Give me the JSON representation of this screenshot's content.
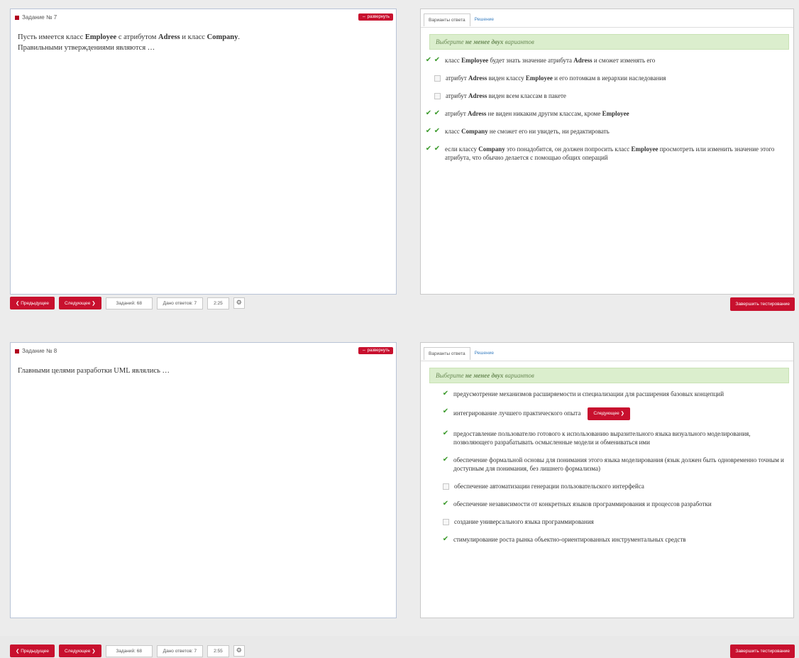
{
  "colors": {
    "accent": "#c8102e",
    "check": "#3c9a2c",
    "hint_bg": "#dbeecd"
  },
  "screens": [
    {
      "task_title": "Задание № 7",
      "expand_label": "⇔ развернуть",
      "question_lines": [
        "Пусть имеется класс <b>Employee</b> с атрибутом <b>Adress</b> и класс <b>Company</b>.",
        "Правильными утверждениями являются …"
      ],
      "tab_answers": "Варианты ответа",
      "tab_solution": "Решение",
      "hint_prefix": "Выберите ",
      "hint_bold": "не менее двух",
      "hint_suffix": " вариантов",
      "options": [
        {
          "checked": true,
          "double": true,
          "text": "класс <b>Employee</b> будет знать значение атрибута <b>Adress</b> и сможет изменять его"
        },
        {
          "checked": false,
          "double": true,
          "text": "атрибут <b>Adress</b> виден классу <b>Employee</b> и его потомкам в иерархии наследования"
        },
        {
          "checked": false,
          "double": true,
          "text": "атрибут <b>Adress</b> виден всем классам в пакете"
        },
        {
          "checked": true,
          "double": true,
          "text": "атрибут <b>Adress</b> не виден никаким другим классам, кроме <b>Employee</b>"
        },
        {
          "checked": true,
          "double": true,
          "text": "класс <b>Company</b> не сможет его ни увидеть, ни редактировать"
        },
        {
          "checked": true,
          "double": true,
          "text": "если классу <b>Company</b> это понадобится, он должен попросить класс <b>Employee</b> просмотреть или изменить значение этого атрибута, что обычно делается с помощью общих операций"
        }
      ],
      "prev_label": "❮ Предыдущее",
      "next_label": "Следующее ❯",
      "tasks_label": "Заданий: 68",
      "answers_label": "Дано ответов: 7",
      "time_label": "2:25",
      "gear_icon": "⚙",
      "finish_label": "Завершить тестирование"
    },
    {
      "task_title": "Задание № 8",
      "expand_label": "⇔ развернуть",
      "question_lines": [
        "Главными целями разработки UML являлись …"
      ],
      "tab_answers": "Варианты ответа",
      "tab_solution": "Решение",
      "hint_prefix": "Выберите ",
      "hint_bold": "не менее двух",
      "hint_suffix": " вариантов",
      "options": [
        {
          "checked": true,
          "double": false,
          "text": "предусмотрение механизмов расширяемости и специализации для расширения базовых концепций"
        },
        {
          "checked": true,
          "double": false,
          "text": "интегрирование лучшего практического опыта",
          "inline_button": "Следующее ❯"
        },
        {
          "checked": true,
          "double": false,
          "text": "предоставление пользователю готового к использованию выразительного языка визуального моделирования, позволяющего разрабатывать осмысленные модели и обмениваться ими"
        },
        {
          "checked": true,
          "double": false,
          "text": "обеспечение формальной основы для понимания этого языка моделирования (язык должен быть одновременно точным и доступным для понимания, без лишнего формализма)"
        },
        {
          "checked": false,
          "double": false,
          "text": "обеспечение автоматизации генерации пользовательского интерфейса"
        },
        {
          "checked": true,
          "double": false,
          "text": "обеспечение независимости от конкретных языков программирования и процессов разработки"
        },
        {
          "checked": false,
          "double": false,
          "text": "создание универсального языка программирования"
        },
        {
          "checked": true,
          "double": false,
          "text": "стимулирование роста рынка объектно-ориентированных инструментальных средств"
        }
      ],
      "prev_label": "❮ Предыдущее",
      "next_label": "Следующее ❯",
      "tasks_label": "Заданий: 68",
      "answers_label": "Дано ответов: 7",
      "time_label": "2:55",
      "gear_icon": "⚙",
      "finish_label": "Завершить тестирование"
    }
  ]
}
